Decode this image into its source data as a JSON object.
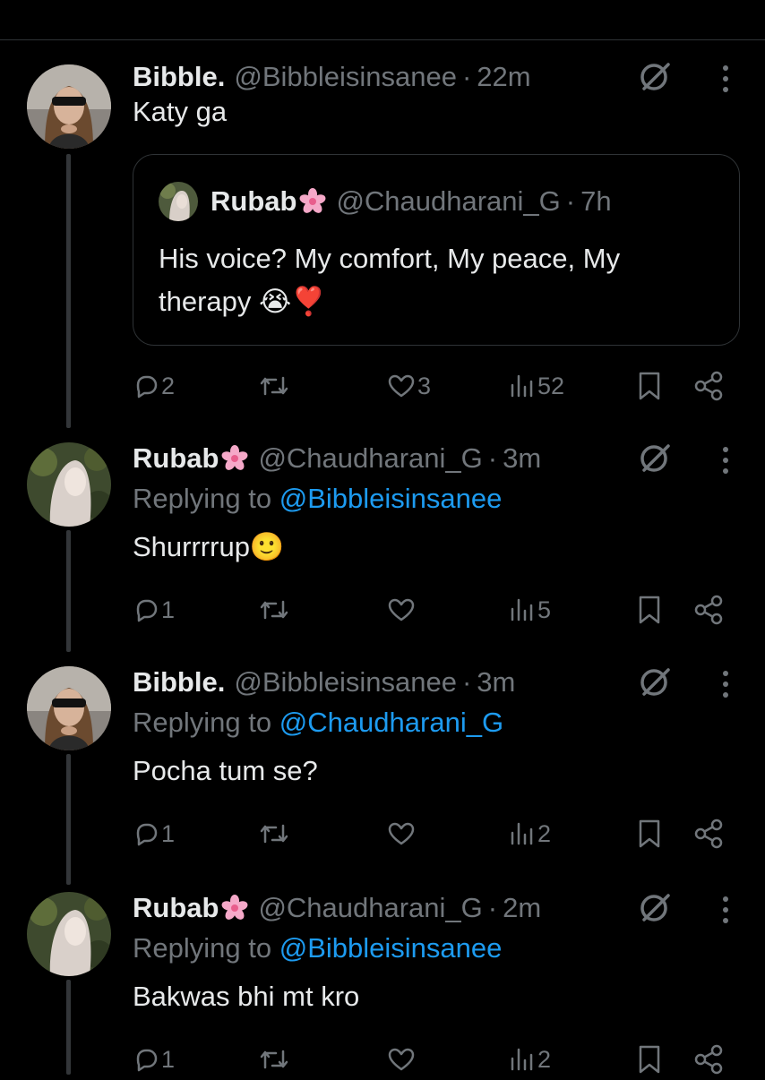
{
  "posts": [
    {
      "name": "Bibble.",
      "has_flower": false,
      "handle": "@Bibbleisinsanee",
      "time": "22m",
      "replying_label": "",
      "replying_to": "",
      "text": "Katy ga",
      "quote": {
        "name": "Rubab",
        "handle": "@Chaudharani_G",
        "time": "7h",
        "text": "His voice? My comfort, My peace, My therapy 😭❣️"
      },
      "stats": {
        "replies": "2",
        "reposts": "",
        "likes": "3",
        "views": "52"
      }
    },
    {
      "name": "Rubab",
      "has_flower": true,
      "handle": "@Chaudharani_G",
      "time": "3m",
      "replying_label": "Replying to",
      "replying_to": "@Bibbleisinsanee",
      "text": "Shurrrrup🙂",
      "stats": {
        "replies": "1",
        "reposts": "",
        "likes": "",
        "views": "5"
      }
    },
    {
      "name": "Bibble.",
      "has_flower": false,
      "handle": "@Bibbleisinsanee",
      "time": "3m",
      "replying_label": "Replying to",
      "replying_to": "@Chaudharani_G",
      "text": "Pocha tum se?",
      "stats": {
        "replies": "1",
        "reposts": "",
        "likes": "",
        "views": "2"
      }
    },
    {
      "name": "Rubab",
      "has_flower": true,
      "handle": "@Chaudharani_G",
      "time": "2m",
      "replying_label": "Replying to",
      "replying_to": "@Bibbleisinsanee",
      "text": "Bakwas bhi mt kro",
      "stats": {
        "replies": "1",
        "reposts": "",
        "likes": "",
        "views": "2"
      }
    }
  ],
  "separator": "·",
  "icons": {
    "reply": "reply-icon",
    "repost": "repost-icon",
    "like": "like-icon",
    "views": "views-icon",
    "bookmark": "bookmark-icon",
    "share": "share-icon",
    "grok": "grok-icon",
    "more": "more-icon",
    "flower": "cherry-blossom-icon"
  },
  "colors": {
    "background": "#000000",
    "text": "#e7e9ea",
    "secondary": "#71767b",
    "link": "#1d9bf0",
    "border": "#2f3336"
  }
}
